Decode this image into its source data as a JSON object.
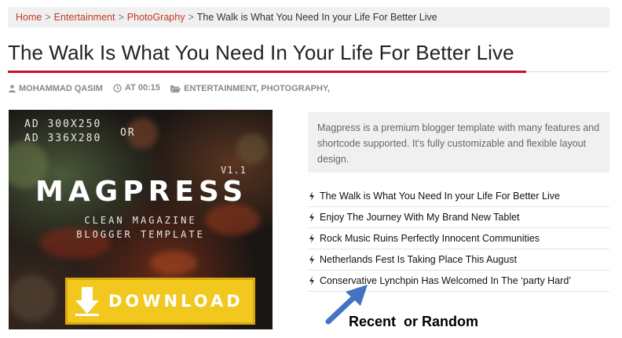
{
  "breadcrumb": {
    "home": "Home",
    "category1": "Entertainment",
    "category2": "PhotoGraphy",
    "current": "The Walk is What You Need In your Life For Better Live",
    "separator": ">"
  },
  "post": {
    "title": "The Walk Is What You Need In Your Life For Better Live",
    "author": "MOHAMMAD QASIM",
    "time": "AT 00:15",
    "labels": "ENTERTAINMENT, PHOTOGRAPHY,"
  },
  "ad": {
    "size_line1": "AD 300X250",
    "size_line2": "AD 336X280",
    "or": "OR",
    "version": "V1.1",
    "brand": "MAGPRESS",
    "tagline1": "CLEAN MAGAZINE",
    "tagline2": "BLOGGER TEMPLATE",
    "button_label": "DOWNLOAD"
  },
  "sidebar": {
    "about": "Magpress is a premium blogger template with many features and shortcode supported. It's fully customizable and flexible layout design.",
    "posts": [
      "The Walk is What You Need In your Life For Better Live",
      "Enjoy The Journey With My Brand New Tablet",
      "Rock Music Ruins Perfectly Innocent Communities",
      "Netherlands Fest Is Taking Place This August",
      "Conservative Lynchpin Has Welcomed In The ‘party Hard’"
    ]
  },
  "annotation": {
    "text": "Recent  or Random"
  },
  "colors": {
    "accent": "#c8102e",
    "link": "#c0392b",
    "download_button": "#f2c81e",
    "arrow": "#4472c4"
  },
  "icons": [
    "user-icon",
    "clock-icon",
    "folder-icon",
    "bolt-icon",
    "download-arrow-icon",
    "arrow-icon"
  ]
}
